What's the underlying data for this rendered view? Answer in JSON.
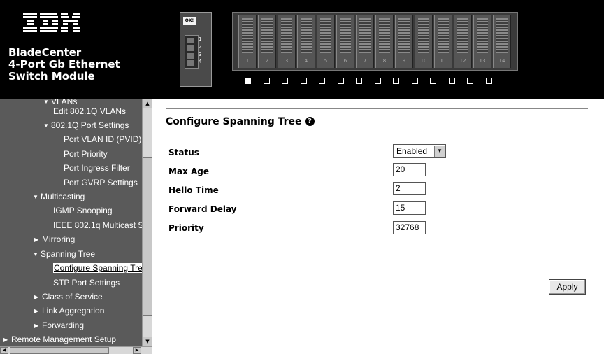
{
  "header": {
    "brand": "IBM",
    "product_lines": [
      "BladeCenter",
      "4-Port Gb Ethernet",
      "Switch Module"
    ],
    "module": {
      "ok_label": "OK!",
      "port_numbers": [
        "1",
        "2",
        "3",
        "4"
      ]
    },
    "chassis": {
      "bay_numbers": [
        "1",
        "2",
        "3",
        "4",
        "5",
        "6",
        "7",
        "8",
        "9",
        "10",
        "11",
        "12",
        "13",
        "14"
      ],
      "selected_bay": "1"
    }
  },
  "sidebar": {
    "items": [
      {
        "label": "VLANs",
        "state": "expanded"
      },
      {
        "label": "Edit 802.1Q VLANs"
      },
      {
        "label": "802.1Q Port Settings",
        "state": "expanded"
      },
      {
        "label": "Port VLAN ID (PVID)"
      },
      {
        "label": "Port Priority"
      },
      {
        "label": "Port Ingress Filter"
      },
      {
        "label": "Port GVRP Settings"
      },
      {
        "label": "Multicasting",
        "state": "expanded"
      },
      {
        "label": "IGMP Snooping"
      },
      {
        "label": "IEEE 802.1q Multicast S"
      },
      {
        "label": "Mirroring",
        "state": "collapsed"
      },
      {
        "label": "Spanning Tree",
        "state": "expanded"
      },
      {
        "label": "Configure Spanning Tre",
        "active": true
      },
      {
        "label": "STP Port Settings"
      },
      {
        "label": "Class of Service",
        "state": "collapsed"
      },
      {
        "label": "Link Aggregation",
        "state": "collapsed"
      },
      {
        "label": "Forwarding",
        "state": "collapsed"
      },
      {
        "label": "Remote Management Setup",
        "state": "collapsed"
      }
    ]
  },
  "main": {
    "title": "Configure Spanning Tree",
    "help_icon": "help-icon",
    "fields": {
      "status": {
        "label": "Status",
        "value": "Enabled"
      },
      "max_age": {
        "label": "Max Age",
        "value": "20"
      },
      "hello_time": {
        "label": "Hello Time",
        "value": "2"
      },
      "forward_delay": {
        "label": "Forward Delay",
        "value": "15"
      },
      "priority": {
        "label": "Priority",
        "value": "32768"
      }
    },
    "apply_label": "Apply"
  }
}
